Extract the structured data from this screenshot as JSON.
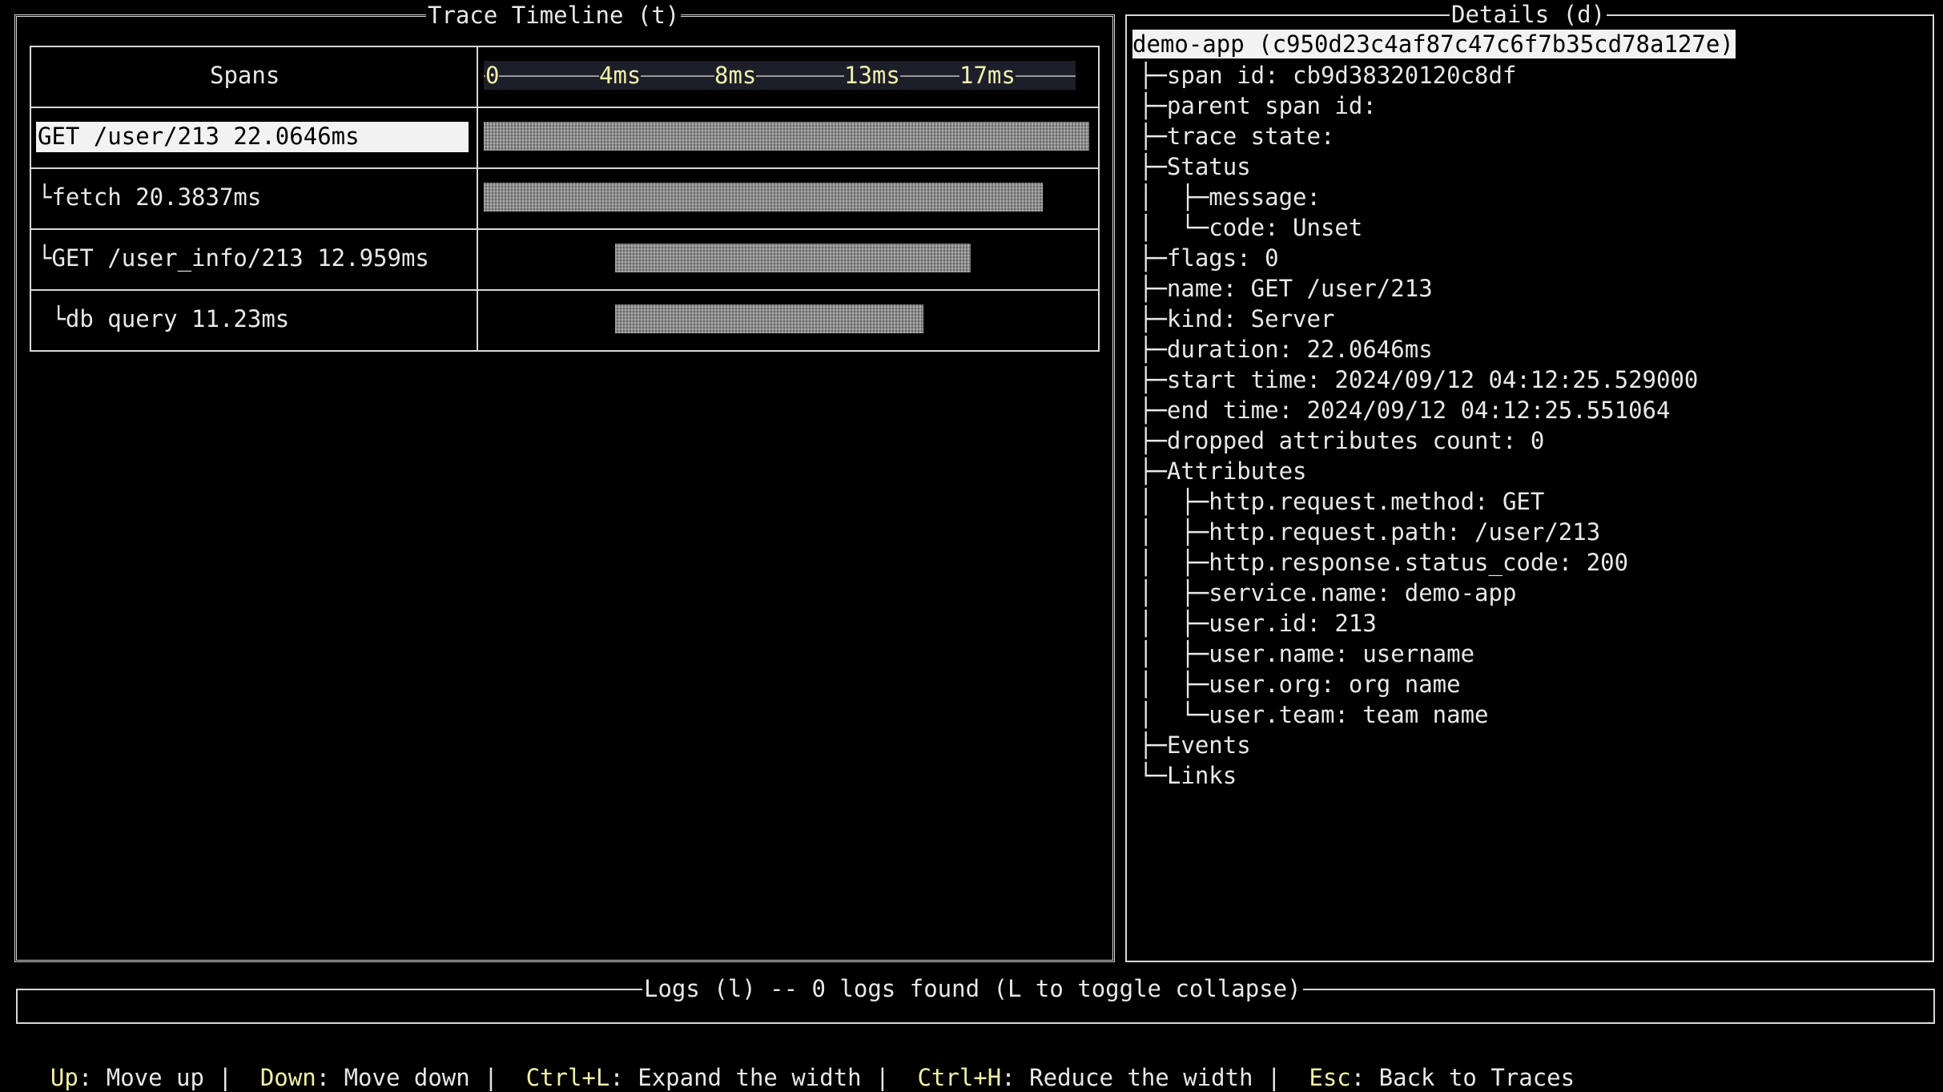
{
  "timeline": {
    "title": "Trace Timeline (t)",
    "spans_header": "Spans",
    "ticks": [
      "0",
      "4ms",
      "8ms",
      "13ms",
      "17ms"
    ],
    "spans": [
      {
        "label": "GET /user/213 22.0646ms",
        "start_ms": 0,
        "duration_ms": 22.0646
      },
      {
        "label": "└fetch 20.3837ms",
        "start_ms": 0,
        "duration_ms": 20.3837
      },
      {
        "label": "└GET /user_info/213 12.959ms",
        "start_ms": 4.8,
        "duration_ms": 12.959
      },
      {
        "label": " └db query 11.23ms",
        "start_ms": 4.8,
        "duration_ms": 11.23
      }
    ]
  },
  "details": {
    "title": "Details (d)",
    "header": "demo-app (c950d23c4af87c47c6f7b35cd78a127e)",
    "tree": [
      "├─span id: cb9d38320120c8df",
      "├─parent span id:",
      "├─trace state:",
      "├─Status",
      "│  ├─message:",
      "│  └─code: Unset",
      "├─flags: 0",
      "├─name: GET /user/213",
      "├─kind: Server",
      "├─duration: 22.0646ms",
      "├─start time: 2024/09/12 04:12:25.529000",
      "├─end time: 2024/09/12 04:12:25.551064",
      "├─dropped attributes count: 0",
      "├─Attributes",
      "│  ├─http.request.method: GET",
      "│  ├─http.request.path: /user/213",
      "│  ├─http.response.status_code: 200",
      "│  ├─service.name: demo-app",
      "│  ├─user.id: 213",
      "│  ├─user.name: username",
      "│  ├─user.org: org name",
      "│  └─user.team: team name",
      "├─Events",
      "└─Links"
    ]
  },
  "logs": {
    "title": "Logs (l) -- 0 logs found (L to toggle collapse)"
  },
  "footer": [
    {
      "key": "Up",
      "desc": ": Move up"
    },
    {
      "key": "Down",
      "desc": ": Move down"
    },
    {
      "key": "Ctrl+L",
      "desc": ": Expand the width"
    },
    {
      "key": "Ctrl+H",
      "desc": ": Reduce the width"
    },
    {
      "key": "Esc",
      "desc": ": Back to Traces"
    }
  ],
  "colors": {
    "tick": "#f0f0a8",
    "selection_bg": "#f2f2f2"
  }
}
